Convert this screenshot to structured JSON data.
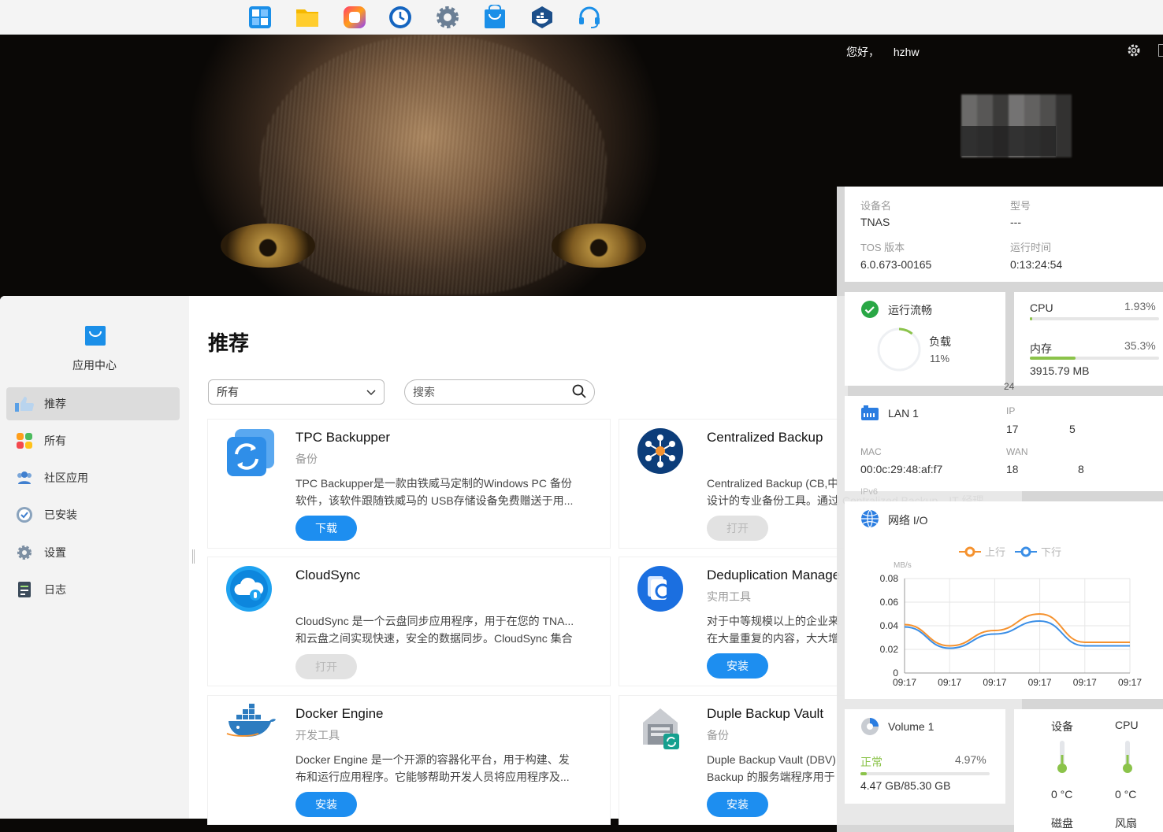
{
  "taskbar": {
    "icons": [
      "dashboard-icon",
      "folder-icon",
      "photos-icon",
      "backup-clock-icon",
      "settings-gear-icon",
      "app-center-bag-icon",
      "docker-icon",
      "support-headset-icon"
    ]
  },
  "header": {
    "greeting": "您好，",
    "username": "hzhw"
  },
  "app_center": {
    "title": "应用中心",
    "sidebar": [
      {
        "label": "推荐",
        "icon": "thumbs-up-icon",
        "active": true
      },
      {
        "label": "所有",
        "icon": "grid-apps-icon",
        "active": false
      },
      {
        "label": "社区应用",
        "icon": "community-users-icon",
        "active": false
      },
      {
        "label": "已安装",
        "icon": "installed-clock-icon",
        "active": false
      },
      {
        "label": "设置",
        "icon": "settings-gear-icon",
        "active": false
      },
      {
        "label": "日志",
        "icon": "log-document-icon",
        "active": false
      }
    ],
    "page_title": "推荐",
    "filter": {
      "value": "所有"
    },
    "search": {
      "placeholder": "搜索"
    },
    "apps": [
      {
        "name": "TPC Backupper",
        "category": "备份",
        "desc1": "TPC Backupper是一款由铁威马定制的Windows PC 备份",
        "desc2": "软件，该软件跟随铁威马的 USB存储设备免费赠送于用...",
        "button": "下载",
        "enabled": true,
        "icon": "tpc-backupper-icon"
      },
      {
        "name": "Centralized Backup",
        "category": "",
        "desc1": "Centralized Backup (CB,中",
        "desc2": "设计的专业备份工具。通过 Centralized Backup，IT 经理",
        "button": "打开",
        "enabled": false,
        "icon": "centralized-backup-icon"
      },
      {
        "name": "CloudSync",
        "category": "",
        "desc1": "CloudSync 是一个云盘同步应用程序，用于在您的 TNA...",
        "desc2": "和云盘之间实现快速，安全的数据同步。CloudSync 集合",
        "button": "打开",
        "enabled": false,
        "icon": "cloudsync-icon"
      },
      {
        "name": "Deduplication Manage",
        "category": "实用工具",
        "desc1": "对于中等规模以上的企业来",
        "desc2": "在大量重复的内容，大大增",
        "button": "安装",
        "enabled": true,
        "icon": "deduplication-icon"
      },
      {
        "name": "Docker Engine",
        "category": "开发工具",
        "desc1": "Docker Engine 是一个开源的容器化平台，用于构建、发",
        "desc2": "布和运行应用程序。它能够帮助开发人员将应用程序及...",
        "button": "安装",
        "enabled": true,
        "icon": "docker-whale-icon"
      },
      {
        "name": "Duple Backup Vault",
        "category": "备份",
        "desc1": "Duple Backup Vault (DBV)",
        "desc2": "Backup 的服务端程序用于",
        "button": "安装",
        "enabled": true,
        "icon": "duple-backup-vault-icon"
      }
    ]
  },
  "system_info": {
    "device_name_label": "设备名",
    "device_name": "TNAS",
    "model_label": "型号",
    "model": "---",
    "tos_label": "TOS 版本",
    "tos": "6.0.673-00165",
    "uptime_label": "运行时间",
    "uptime": "0:13:24:54"
  },
  "health": {
    "status": "运行流畅",
    "load_label": "负载",
    "load_value": "11%",
    "load_fraction": 0.11
  },
  "resources": {
    "cpu_label": "CPU",
    "cpu_value": "1.93%",
    "cpu_fraction": 0.0193,
    "mem_label": "内存",
    "mem_value": "35.3%",
    "mem_fraction": 0.353,
    "mem_used": "3915.79 MB",
    "stray_number": "24"
  },
  "network": {
    "lan_label": "LAN 1",
    "ip_label": "IP",
    "ip_partial_start": "17",
    "ip_partial_end": "5",
    "mac_label": "MAC",
    "mac": "00:0c:29:48:af:f7",
    "wan_label": "WAN",
    "wan_partial_start": "18",
    "wan_partial_end": "8",
    "ipv6_label": "IPv6"
  },
  "network_io": {
    "title": "网络 I/O",
    "legend_up": "上行",
    "legend_down": "下行",
    "up_color": "#f5922f",
    "down_color": "#3a8ee6"
  },
  "chart_data": {
    "type": "line",
    "ylabel": "MB/s",
    "yticks": [
      "0.08",
      "0.06",
      "0.04",
      "0.02",
      "0"
    ],
    "ylim": [
      0,
      0.08
    ],
    "categories": [
      "09:17",
      "09:17",
      "09:17",
      "09:17",
      "09:17",
      "09:17"
    ],
    "x": [
      0,
      1,
      2,
      3,
      4,
      5
    ],
    "series": [
      {
        "name": "上行",
        "values": [
          0.041,
          0.023,
          0.036,
          0.05,
          0.026,
          0.026
        ]
      },
      {
        "name": "下行",
        "values": [
          0.039,
          0.021,
          0.033,
          0.044,
          0.023,
          0.023
        ]
      }
    ],
    "grid": true,
    "legend": "top-center"
  },
  "volume": {
    "name": "Volume 1",
    "status": "正常",
    "usage": "4.97%",
    "usage_fraction": 0.0497,
    "capacity": "4.47 GB/85.30 GB"
  },
  "temperatures": [
    {
      "top_label": "设备",
      "value": "0 °C",
      "bottom_label": "磁盘"
    },
    {
      "top_label": "CPU",
      "value": "0 °C",
      "bottom_label": "风扇"
    }
  ]
}
